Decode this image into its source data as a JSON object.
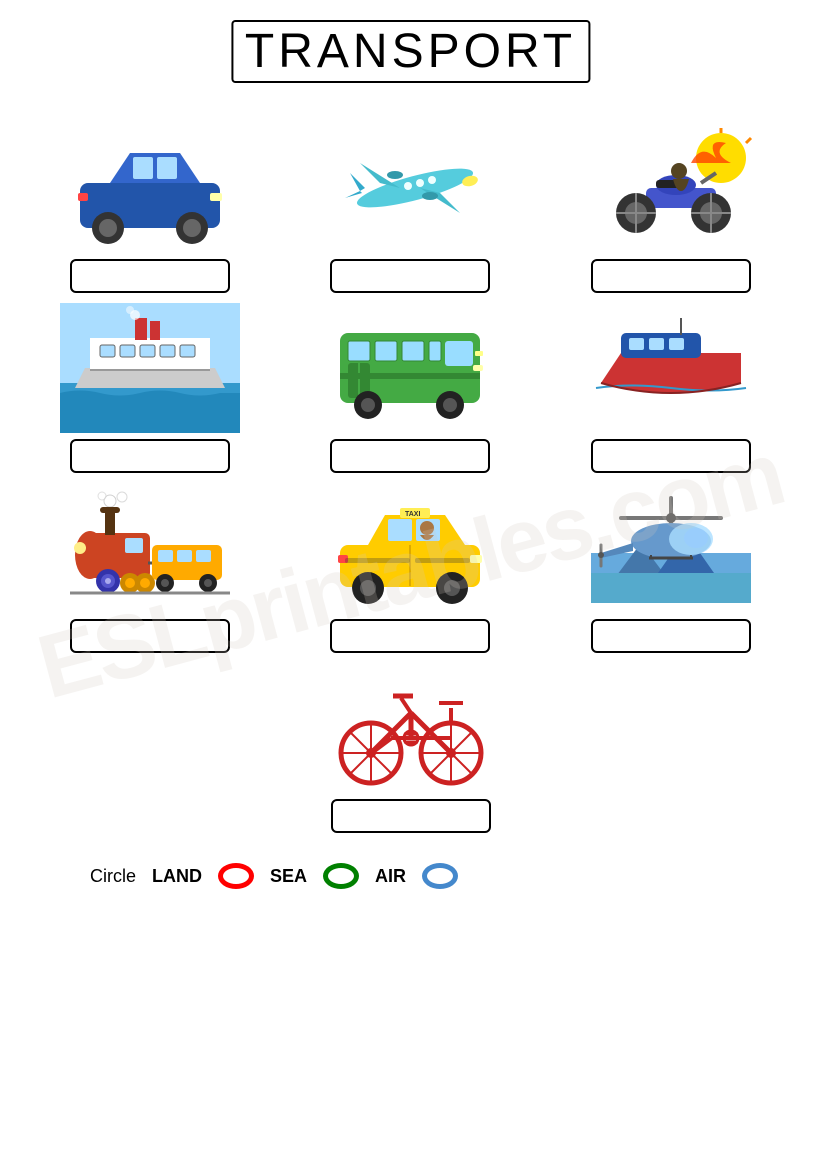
{
  "title": "TRANSPORT",
  "watermark": "ESLprintables.com",
  "vehicles": [
    {
      "name": "car",
      "label": ""
    },
    {
      "name": "airplane",
      "label": ""
    },
    {
      "name": "motorcycle",
      "label": ""
    },
    {
      "name": "ferry",
      "label": ""
    },
    {
      "name": "bus",
      "label": ""
    },
    {
      "name": "boat",
      "label": ""
    },
    {
      "name": "train",
      "label": ""
    },
    {
      "name": "taxi",
      "label": ""
    },
    {
      "name": "helicopter",
      "label": ""
    },
    {
      "name": "bicycle",
      "label": ""
    }
  ],
  "legend": {
    "instruction": "Circle",
    "items": [
      {
        "label": "LAND",
        "color": "red"
      },
      {
        "label": "SEA",
        "color": "green"
      },
      {
        "label": "AIR",
        "color": "blue"
      }
    ]
  }
}
